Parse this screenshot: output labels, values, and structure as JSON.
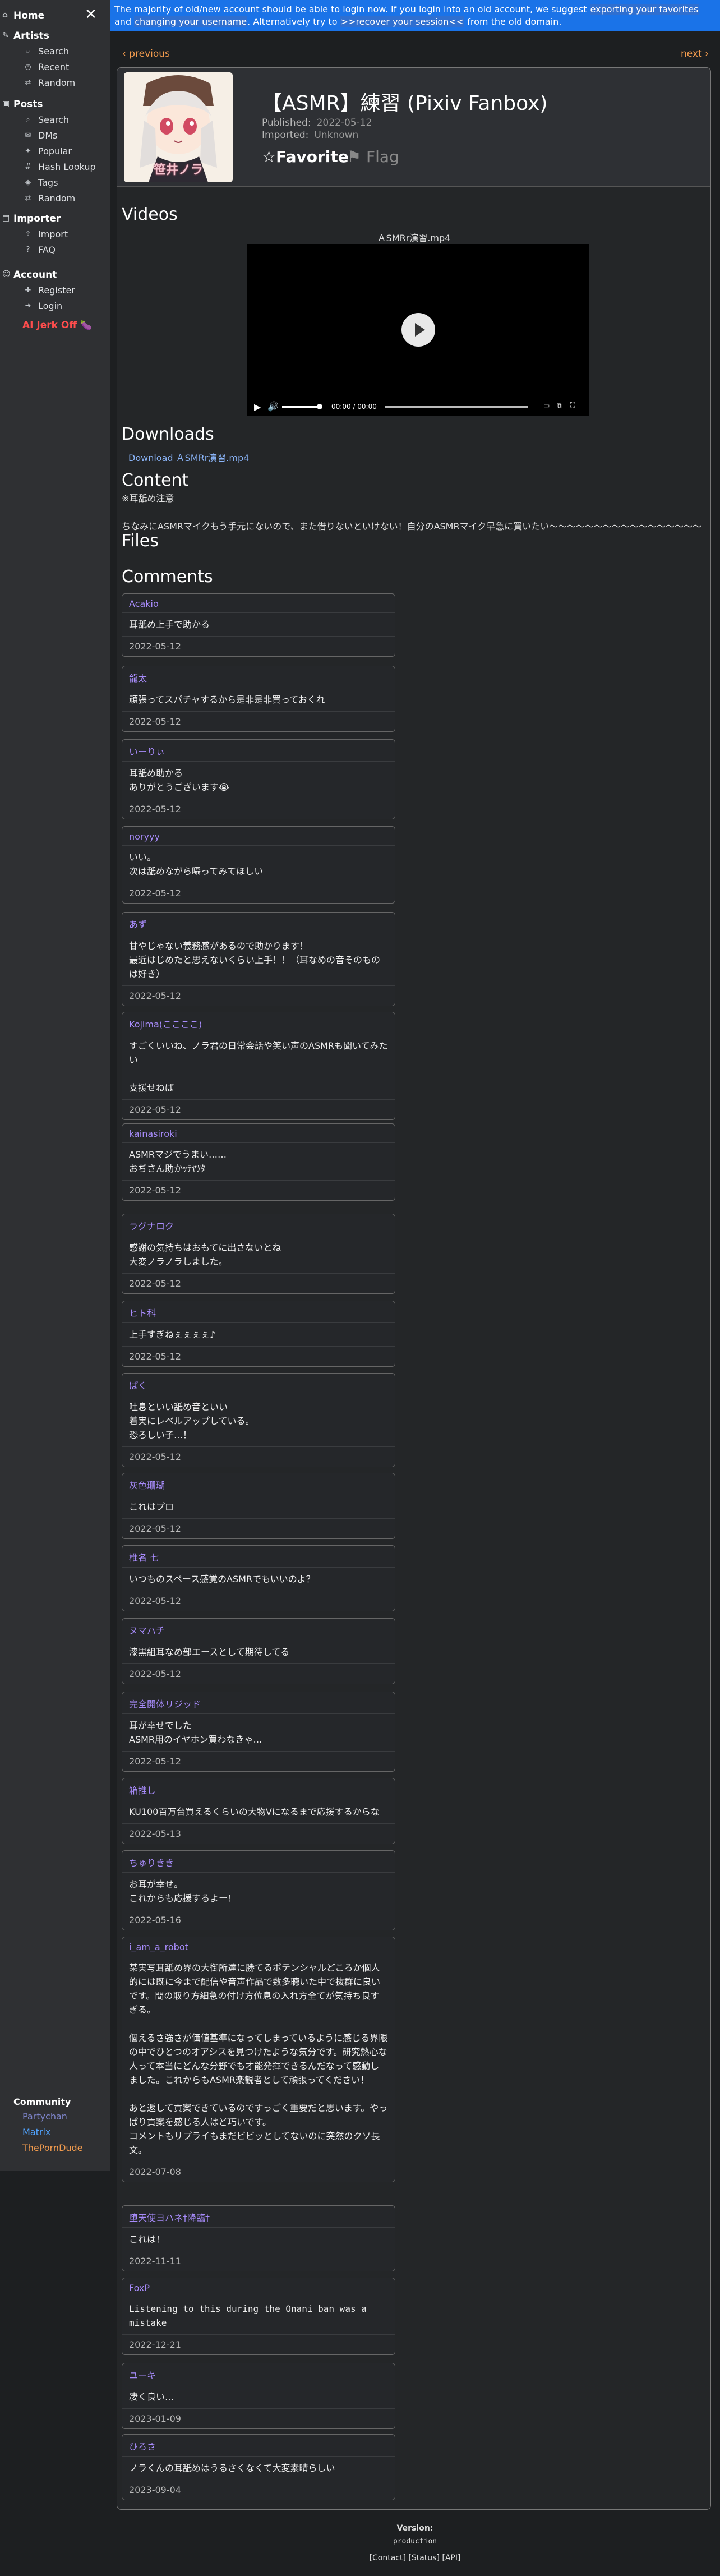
{
  "banner": {
    "text1": "The majority of old/new account should be able to login now. If you login into an old account, we suggest",
    "link1": "exporting your favorites",
    "and": " and ",
    "link2": "changing your username",
    "text2": ". Alternatively try to ",
    "link3": ">>recover your session<<",
    "text3": " from the old domain."
  },
  "sidebar": {
    "home": "Home",
    "artists": "Artists",
    "artists_items": [
      "Search",
      "Recent",
      "Random"
    ],
    "posts": "Posts",
    "posts_items": [
      "Search",
      "DMs",
      "Popular",
      "Hash Lookup",
      "Tags",
      "Random"
    ],
    "importer": "Importer",
    "importer_items": [
      "Import",
      "FAQ"
    ],
    "account": "Account",
    "account_items": [
      "Register",
      "Login"
    ],
    "jerk_off": "AI Jerk Off 🍆",
    "community": "Community",
    "community_links": [
      "Partychan",
      "Matrix",
      "ThePornDude"
    ],
    "colors": {
      "partychan": "#7c83c8",
      "matrix": "#4fa3ff",
      "porndude": "#f29b4e"
    }
  },
  "nav": {
    "previous": "‹ previous",
    "next": "next ›"
  },
  "post": {
    "avatar_name": "笹井ノラ",
    "title": "【ASMR】練習 (Pixiv Fanbox)",
    "published_label": "Published:",
    "published": "2022-05-12",
    "imported_label": "Imported:",
    "imported": "Unknown",
    "favorite": "☆Favorite",
    "flag": "⚑ Flag"
  },
  "videos": {
    "heading": "Videos",
    "file_name": "ＡSMRr演習.mp4",
    "time": "00:00 / 00:00"
  },
  "downloads": {
    "heading": "Downloads",
    "link": "Download ＡSMRr演習.mp4"
  },
  "content": {
    "heading": "Content",
    "line1": "※耳舐め注意",
    "line2": "ちなみにASMRマイクもう手元にないので、また借りないといけない！自分のASMRマイク早急に買いたい〜〜〜〜〜〜〜〜〜〜〜〜〜〜〜〜〜"
  },
  "files": {
    "heading": "Files"
  },
  "comments": {
    "heading": "Comments",
    "items": [
      {
        "author": "Acakio",
        "body": "耳舐め上手で助かる",
        "date": "2022-05-12"
      },
      {
        "author": "龍太",
        "body": "頑張ってスパチャするから是非是非買っておくれ",
        "date": "2022-05-12"
      },
      {
        "author": "いーりぃ",
        "body": "耳舐め助かる\nありがとうございます😭",
        "date": "2022-05-12"
      },
      {
        "author": "noryyy",
        "body": "いい。\n次は舐めながら囁ってみてほしい",
        "date": "2022-05-12"
      },
      {
        "author": "あず",
        "body": "甘やじゃない義務感があるので助かります！\n最近はじめたと思えないくらい上手！！（耳なめの音そのものは好き）",
        "date": "2022-05-12"
      },
      {
        "author": "Kojima(ここここ)",
        "body": "すごくいいね、ノラ君の日常会話や笑い声のASMRも聞いてみたい\n\n支援せねば",
        "date": "2022-05-12"
      },
      {
        "author": "kainasiroki",
        "body": "ASMRマジでうまい……\nおぢさん助かｯﾃﾔﾂﾀ",
        "date": "2022-05-12"
      },
      {
        "author": "ラグナロク",
        "body": "感謝の気持ちはおもてに出さないとね\n大変ノラノラしました。",
        "date": "2022-05-12"
      },
      {
        "author": "ヒト科",
        "body": "上手すぎねぇぇぇぇ♪",
        "date": "2022-05-12"
      },
      {
        "author": "ぱく",
        "body": "吐息といい舐め音といい\n着実にレベルアップしている。\n恐ろしい子…！",
        "date": "2022-05-12"
      },
      {
        "author": "灰色珊瑚",
        "body": "これはプロ",
        "date": "2022-05-12"
      },
      {
        "author": "椎名 七",
        "body": "いつものスペース感覚のASMRでもいいのよ？",
        "date": "2022-05-12"
      },
      {
        "author": "ヌマハチ",
        "body": "漆黒組耳なめ部エースとして期待してる",
        "date": "2022-05-12"
      },
      {
        "author": "完全開体リジッド",
        "body": "耳が幸せでした\nASMR用のイヤホン買わなきゃ…",
        "date": "2022-05-12"
      },
      {
        "author": "箱推し",
        "body": "KU100百万台買えるくらいの大物Vになるまで応援するからな",
        "date": "2022-05-13"
      },
      {
        "author": "ちゅりきき",
        "body": "お耳が幸せ。\nこれからも応援するよー！",
        "date": "2022-05-16"
      },
      {
        "author": "i_am_a_robot",
        "body": "某実写耳舐め界の大御所達に勝てるポテンシャルどころか個人的には既に今まで配信や音声作品で数多聴いた中で抜群に良いです。間の取り方細急の付け方位息の入れ方全てが気持ち良すぎる。\n\n個えるさ強さが価値基準になってしまっているように感じる界限の中でひとつのオアシスを見つけたような気分です。研究熱心な人って本当にどんな分野でも才能発揮できるんだなって感動しました。これからもASMR楽観者として頑張ってください！\n\nあと返して貢案できているのですっごく重要だと思います。やっぱり貢案を感じる人はど巧いです。\nコメントもリプライもまだビビッとしてないのに突然のクソ長文。",
        "date": "2022-07-08"
      },
      {
        "author": "堕天使ヨハネ†降臨†",
        "body": "これは！",
        "date": "2022-11-11"
      },
      {
        "author": "FoxP",
        "body": "Listening to this during the Onani ban was a\nmistake",
        "date": "2022-12-21"
      },
      {
        "author": "ユーキ",
        "body": "凄く良い…",
        "date": "2023-01-09"
      },
      {
        "author": "ひろさ",
        "body": "ノラくんの耳舐めはうるさくなくて大変素晴らしい",
        "date": "2023-09-04"
      }
    ]
  },
  "footer": {
    "version_label": "Version:",
    "version": "production",
    "links": "[Contact]  [Status]  [API]"
  }
}
